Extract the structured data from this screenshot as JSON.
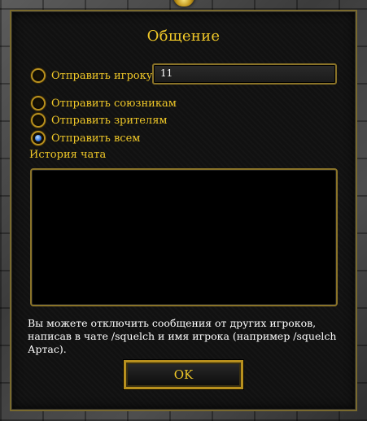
{
  "dialog": {
    "title": "Общение",
    "send_options": [
      {
        "label": "Отправить игроку",
        "selected": false
      },
      {
        "label": "Отправить союзникам",
        "selected": false
      },
      {
        "label": "Отправить зрителям",
        "selected": false
      },
      {
        "label": "Отправить всем",
        "selected": true
      }
    ],
    "player_name_value": "11",
    "history_label": "История чата",
    "help_text": "Вы можете отключить сообщения от других игроков, написав в чате /squelch и имя игрока (например /squelch Артас).",
    "ok_label": "OK"
  },
  "colors": {
    "gold_text": "#f0c828",
    "frame_gold": "#8a7328",
    "selected_radio": "#3c7ee6"
  }
}
